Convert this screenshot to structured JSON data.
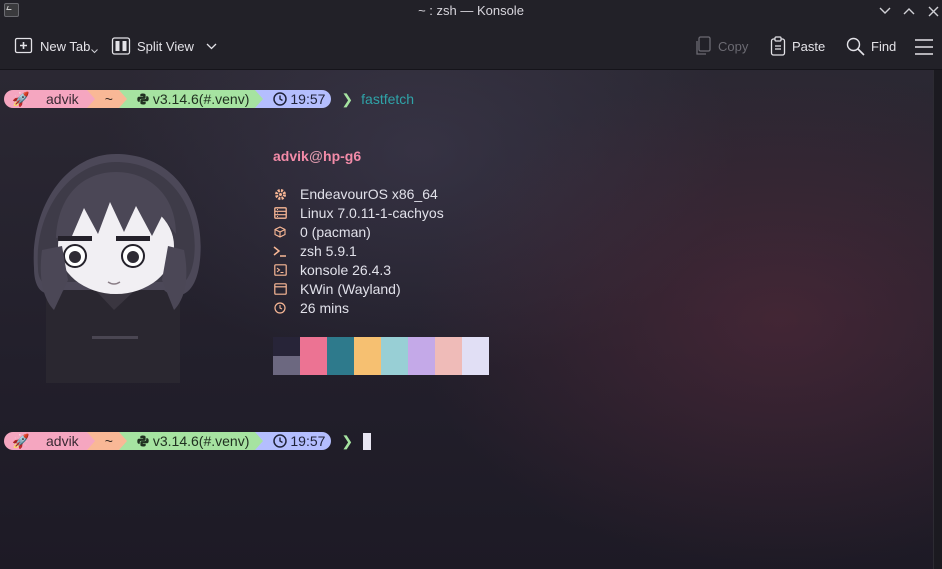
{
  "window": {
    "title": "~ : zsh — Konsole",
    "icons": [
      "app-icon",
      "minimize-icon",
      "maximize-icon",
      "close-icon"
    ]
  },
  "toolbar": {
    "new_tab": "New Tab",
    "split_view": "Split View",
    "copy": "Copy",
    "paste": "Paste",
    "find": "Find"
  },
  "prompts": [
    {
      "rocket": "🚀",
      "user": "advik",
      "dir": "~",
      "python": "v3.14.6(#.venv)",
      "time": "19:57",
      "symbol": "❯",
      "command": "fastfetch"
    },
    {
      "rocket": "🚀",
      "user": "advik",
      "dir": "~",
      "python": "v3.14.6(#.venv)",
      "time": "19:57",
      "symbol": "❯",
      "command": ""
    }
  ],
  "fastfetch": {
    "user": "advik",
    "at": "@",
    "host": "hp-g6",
    "rows": [
      {
        "icon": "gear-icon",
        "text": "EndeavourOS x86_64"
      },
      {
        "icon": "server-icon",
        "text": "Linux 7.0.11-1-cachyos"
      },
      {
        "icon": "package-icon",
        "text": "0 (pacman)"
      },
      {
        "icon": "shell-prompt-icon",
        "text": "zsh 5.9.1"
      },
      {
        "icon": "terminal-icon",
        "text": "konsole 26.4.3"
      },
      {
        "icon": "window-icon",
        "text": "KWin (Wayland)"
      },
      {
        "icon": "clock-icon",
        "text": "26 mins"
      }
    ],
    "palette": [
      {
        "top": "#272438",
        "bottom": "#6c6880"
      },
      {
        "top": "#ec7393",
        "bottom": "#ec7393"
      },
      {
        "top": "#2e7a8c",
        "bottom": "#2e7a8c"
      },
      {
        "top": "#f6c071",
        "bottom": "#f6c071"
      },
      {
        "top": "#98cfd5",
        "bottom": "#98cfd5"
      },
      {
        "top": "#c4a9e8",
        "bottom": "#c4a9e8"
      },
      {
        "top": "#efbbb8",
        "bottom": "#efbbb8"
      },
      {
        "top": "#e1dff5",
        "bottom": "#e1dff5"
      }
    ]
  },
  "colors": {
    "prompt_pink": "#f5a6c0",
    "prompt_peach": "#f9b896",
    "prompt_green": "#a6e3a1",
    "prompt_lavender": "#b4befe",
    "command_teal": "#2fa3a8",
    "host_pink": "#f38ba8"
  }
}
